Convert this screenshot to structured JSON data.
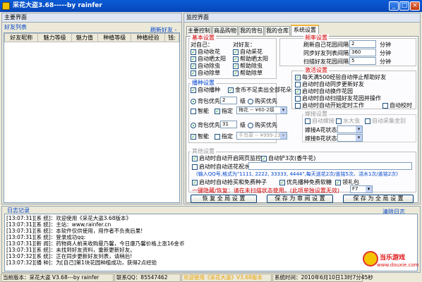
{
  "window": {
    "title": "采花大盗3.68-----by rainfer",
    "min": "_",
    "max": "□",
    "close": "×"
  },
  "left": {
    "title": "主要界面",
    "tab": "好友列表",
    "refresh": "刷新好友 -",
    "columns": [
      "好友昵称",
      "魅力等级",
      "魅力值",
      "种植等级",
      "种植经验",
      "钱:"
    ]
  },
  "monitor": {
    "title": "监控界面"
  },
  "tabs": [
    "主要控制",
    "商品购物",
    "我的背包",
    "我的仓库",
    "系统设置"
  ],
  "basic": {
    "title": "基本设置",
    "self": "对自己：",
    "friend": "对好友：",
    "self_items": [
      "自动收花",
      "自动晒太阳",
      "自动除虫",
      "自动除草"
    ],
    "friend_items": [
      "自动采花",
      "帮助晒太阳",
      "帮助除虫",
      "帮助除草"
    ]
  },
  "cfg": {
    "title": "频率设置",
    "rows": [
      {
        "label": "刷新自己花园间隔",
        "value": "2",
        "unit": "分钟"
      },
      {
        "label": "同步好友列表间隔",
        "value": "360",
        "unit": "分钟"
      },
      {
        "label": "扫描好友花园间隔",
        "value": "5",
        "unit": "分钟"
      }
    ]
  },
  "plant": {
    "title": "播种设置",
    "auto": "自动播种",
    "buy": "金币不足卖出全部花朵",
    "pack1": "背包优先",
    "lv1": "2",
    "lv_unit": "级",
    "shop1": "购买优先",
    "smart": "智能",
    "fixed": "指定",
    "seed1": "梅花 -- ¥60-2级",
    "pack2": "背包优先",
    "lv2": "31",
    "shop2": "购买优先",
    "smart2": "智能",
    "fixed2": "指定",
    "seed2": "千鸟草 -- ¥999-23级"
  },
  "fav": {
    "title": "激活设置",
    "items": [
      "每天满500经验自动停止帮助好友",
      "启动时自动同步更新好友",
      "启动时自动换作花园",
      "启动时自动扫描好友花园并操作",
      "启动时自动开始定时工作"
    ],
    "timer": "自动校时"
  },
  "fert": {
    "title": "嫁接设置",
    "auto": "自动嫁接",
    "water": "水大虫",
    "help": "自动采集金别",
    "s1": "嫁接A花状态",
    "s2": "嫁接B花状态"
  },
  "other": {
    "title": "其他设置",
    "startmon": "启动时自动开启网页监控",
    "autopet": "自动铲3次(香牛花)",
    "msg": "启动时自动送花祝水",
    "hint": "(输入QQ号,格式为\"1111, 2222, 33333, 4444\",每天送花2次/盖铭5次、浇水1次/盖铭2次)",
    "autobuy": "启动时自动抢买和免费种子",
    "priority": "优先播种免费软糖",
    "gift": "领礼包",
    "onekey": "一键隐藏/恢复：请在未扫描状态使用。(此项单独设置无效)",
    "key": "F7",
    "b1": "恢 复 全 局 设 置",
    "b2": "保 存 为 审 阅 设 置",
    "b3": "保 存 为 全 局 设 置"
  },
  "log": {
    "title": "日志记录",
    "clear": "清除日志",
    "lines": [
      "[13:07:31][系 统]：欢迎使用《采花大盗3.68版本》",
      "[13:07:31][系 统]：主站：www.rainfer.cn",
      "[13:07:31][系 统]：本软件仅供使用，用作者不负责后果!",
      "[13:07:31][系 统]：登录成功qq:",
      "[13:07:31][新 闻]：药物商人前来收购曼乃馨，今日康乃馨价格上涨16金币",
      "[13:07:31][系 统]：未找到好友资料，重新更新好友。",
      "[13:07:32][系 统]：正在同步更新好友列表，请稍后!",
      "[13:07:32][播 种]：为[自己]第1块花园种植成功，获得2点经验"
    ]
  },
  "status": {
    "version": "当前版本：采花大盗 V3.68---by rainfer",
    "qq": "联系QQ：85547462",
    "welcome": "欢迎使用《采花大盗》V3.68版本",
    "time": "系统时间：2010年6月10日13时7分45秒"
  },
  "watermark": {
    "brand": "当乐游戏",
    "site": "www.douxie.com"
  }
}
